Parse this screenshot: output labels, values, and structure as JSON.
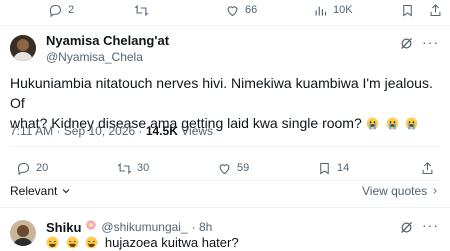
{
  "top_actions": {
    "replies": "2",
    "likes": "66",
    "views": "10K"
  },
  "tweet": {
    "author_name": "Nyamisa Chelang'at",
    "author_handle": "@Nyamisa_Chela",
    "text_line1": "Hukuniambia nitatouch nerves hivi. Nimekiwa kuambiwa I'm jealous. Of",
    "text_line2": "what? Kidney disease ama getting laid kwa single room?",
    "emojis": [
      "crying-face",
      "crying-face",
      "crying-face"
    ],
    "timestamp": "7:11 AM · Sep 10, 2026 · ",
    "views_count": "14.5K",
    "views_label": " Views",
    "replies": "20",
    "retweets": "30",
    "likes": "59",
    "bookmarks": "14"
  },
  "sort": {
    "label": "Relevant",
    "view_quotes": "View quotes"
  },
  "reply": {
    "author_name": "Shiku",
    "author_handle": "@shikumungai_",
    "time": "· 8h",
    "text": "hujazoea kuitwa hater?",
    "emojis": [
      "laughing-face",
      "laughing-face",
      "laughing-face"
    ]
  },
  "colors": {
    "text": "#0f1419",
    "secondary": "#536471",
    "divider": "#eff3f4"
  }
}
